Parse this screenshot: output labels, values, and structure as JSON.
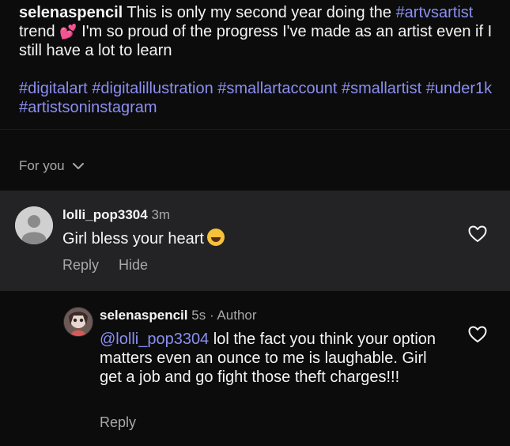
{
  "caption": {
    "username": "selenaspencil",
    "text_1": "This is only my second year doing the",
    "tag_trend": "#artvsartist",
    "text_2": "trend",
    "emoji": "💕",
    "text_3": "I'm so proud of the progress I've made as an artist even if I still have a lot to learn",
    "hashtags": [
      "#digitalart",
      "#digitalillustration",
      "#smallartaccount",
      "#smallartist",
      "#under1k",
      "#artistsoninstagram"
    ]
  },
  "sort": {
    "label": "For you",
    "icon": "chevron-down-icon"
  },
  "comments": [
    {
      "username": "lolli_pop3304",
      "time": "3m",
      "text": "Girl bless your heart",
      "emoji": "laughing-face-icon",
      "actions": [
        "Reply",
        "Hide"
      ]
    },
    {
      "username": "selenaspencil",
      "time": "5s",
      "badge": "Author",
      "mention": "@lolli_pop3304",
      "text": "lol the fact you think your option matters even an ounce to me is laughable. Girl get a job and go fight those theft charges!!!",
      "actions": [
        "Reply"
      ]
    }
  ],
  "colors": {
    "background": "#0c0c0d",
    "highlight": "#232325",
    "link": "#8b8ff2",
    "muted": "#a8a8a8"
  }
}
